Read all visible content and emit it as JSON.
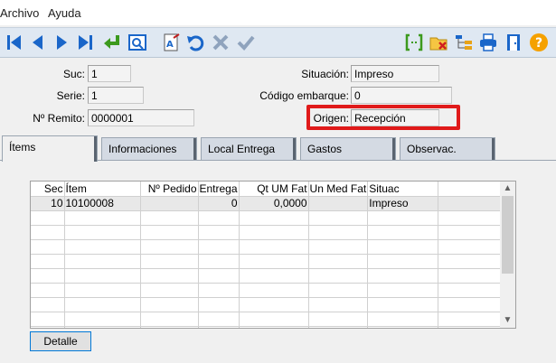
{
  "menu": {
    "archivo": "Archivo",
    "ayuda": "Ayuda"
  },
  "toolbar": {
    "icons": [
      "first-record-icon",
      "previous-record-icon",
      "next-record-icon",
      "last-record-icon",
      "enter-icon",
      "preview-icon",
      "edit-document-icon",
      "undo-icon",
      "cancel-icon",
      "confirm-icon",
      "bracket-field-icon",
      "folder-delete-icon",
      "tree-icon",
      "printer-icon",
      "exit-door-icon",
      "help-icon"
    ]
  },
  "form": {
    "suc_label": "Suc:",
    "suc_value": "1",
    "serie_label": "Serie:",
    "serie_value": "1",
    "remito_label": "Nº Remito:",
    "remito_value": "0000001",
    "situacion_label": "Situación:",
    "situacion_value": "Impreso",
    "codigo_label": "Código embarque:",
    "codigo_value": "0",
    "origen_label": "Origen:",
    "origen_value": "Recepción",
    "highlight_color": "#e01a1a"
  },
  "tabs": [
    "Ítems",
    "Informaciones",
    "Local Entrega",
    "Gastos",
    "Observac."
  ],
  "grid": {
    "headers": [
      "Sec",
      "Ítem",
      "Nº Pedido",
      "Entrega",
      "Qt UM Fat",
      "Un Med Fat",
      "Situac"
    ],
    "rows": [
      [
        "10",
        "10100008",
        "",
        "0",
        "0,0000",
        "",
        "Impreso"
      ]
    ]
  },
  "buttons": {
    "detalle": "Detalle"
  }
}
